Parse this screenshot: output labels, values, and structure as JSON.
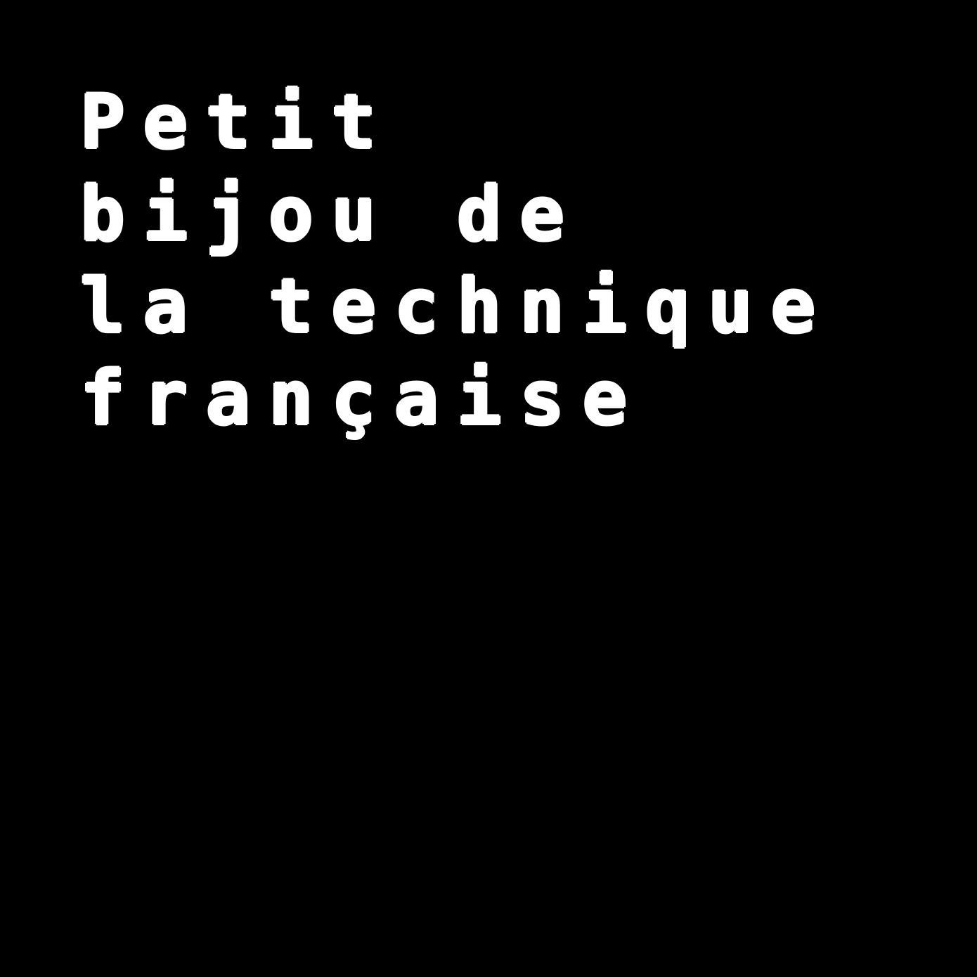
{
  "background_color": "#000000",
  "text_color": "#ffffff",
  "lines": [
    "Petit",
    "bijou de",
    "la technique",
    "française"
  ]
}
